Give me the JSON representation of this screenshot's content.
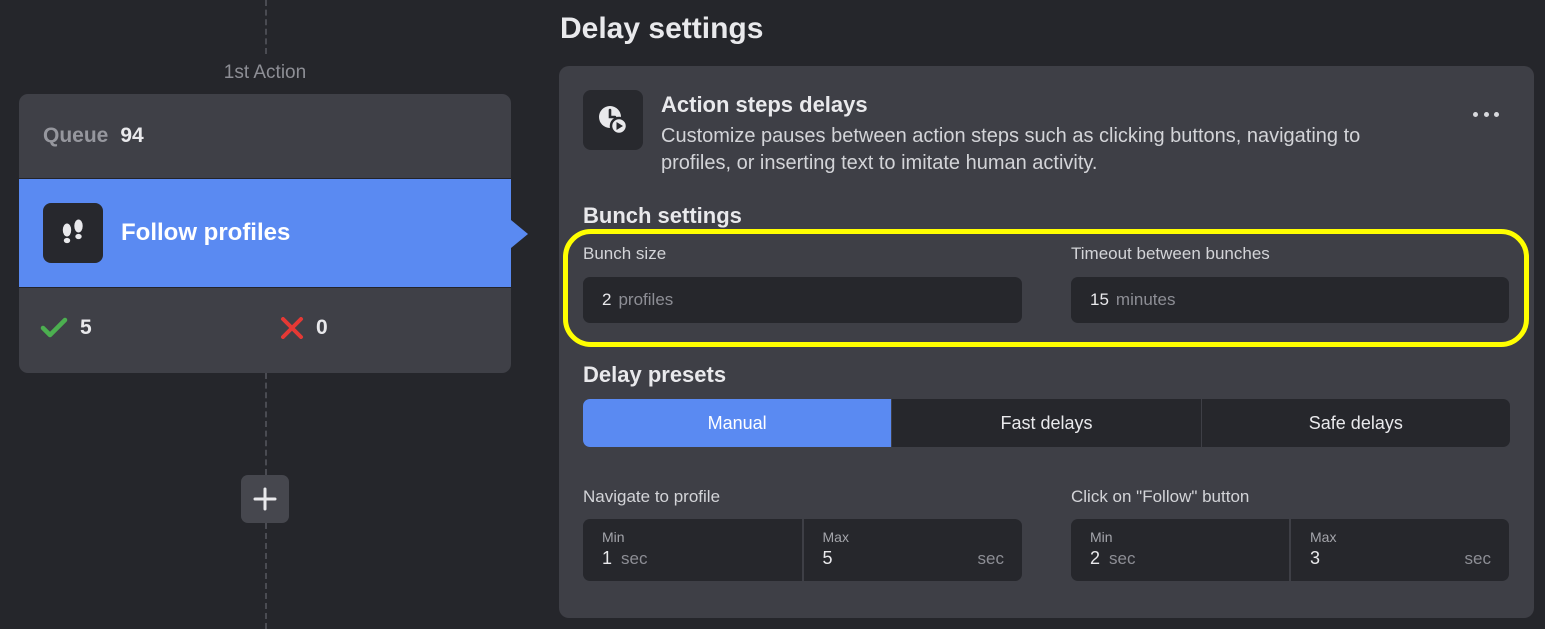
{
  "left": {
    "step_label": "1st Action",
    "queue": {
      "label": "Queue",
      "value": "94"
    },
    "action": {
      "title": "Follow profiles",
      "icon": "footprints-icon"
    },
    "stats": {
      "success_count": "5",
      "fail_count": "0",
      "success_color": "#4caf50",
      "fail_color": "#e53935"
    },
    "add_icon": "plus-icon"
  },
  "section_title": "Delay settings",
  "panel": {
    "header": {
      "icon": "clock-play-icon",
      "title": "Action steps delays",
      "description": "Customize pauses between action steps such as clicking buttons, navigating to profiles, or inserting text to imitate human activity."
    },
    "bunch": {
      "title": "Bunch settings",
      "size_label": "Bunch size",
      "size_value": "2",
      "size_unit": "profiles",
      "timeout_label": "Timeout between bunches",
      "timeout_value": "15",
      "timeout_unit": "minutes"
    },
    "presets": {
      "title": "Delay presets",
      "options": [
        "Manual",
        "Fast delays",
        "Safe delays"
      ],
      "selected": "Manual"
    },
    "delays": [
      {
        "label": "Navigate to profile",
        "min_label": "Min",
        "min": "1",
        "max_label": "Max",
        "max": "5",
        "unit": "sec"
      },
      {
        "label": "Click on \"Follow\" button",
        "min_label": "Min",
        "min": "2",
        "max_label": "Max",
        "max": "3",
        "unit": "sec"
      }
    ]
  },
  "colors": {
    "accent": "#5a8af2",
    "highlight": "#ffff00",
    "background": "#25262b",
    "panel": "#3e3f46"
  }
}
